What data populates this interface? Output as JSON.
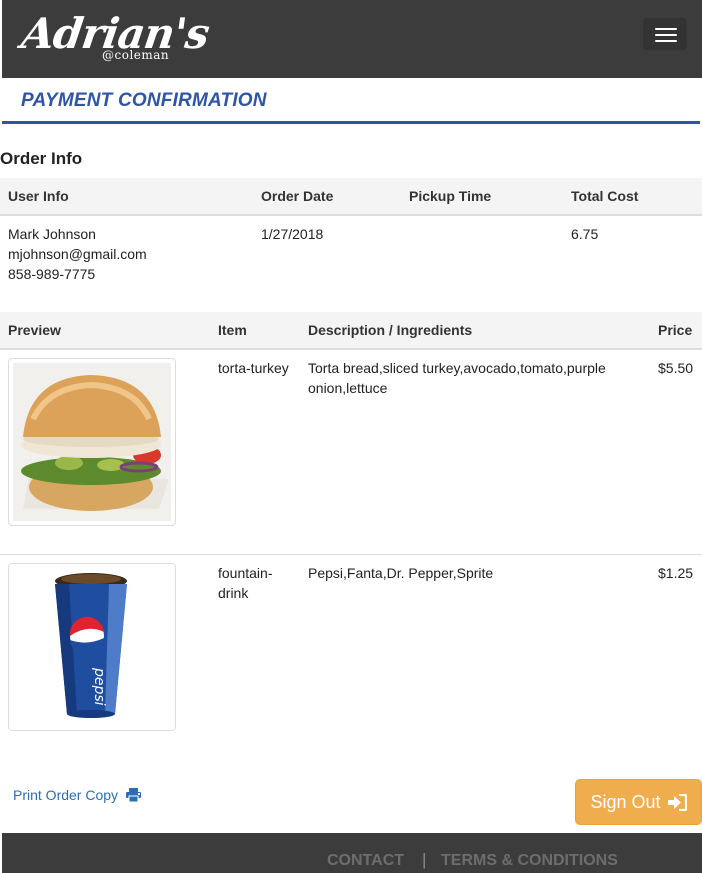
{
  "brand": {
    "name": "Adrian's",
    "sub": "@coleman"
  },
  "nav": {
    "menu_icon": "hamburger-icon"
  },
  "page_title": "PAYMENT CONFIRMATION",
  "order_info": {
    "heading": "Order Info",
    "columns": [
      "User Info",
      "Order Date",
      "Pickup Time",
      "Total Cost"
    ],
    "user": {
      "name": "Mark Johnson",
      "email": "mjohnson@gmail.com",
      "phone": "858-989-7775"
    },
    "order_date": "1/27/2018",
    "pickup_time": "",
    "total_cost": "6.75"
  },
  "items_table": {
    "columns": [
      "Preview",
      "Item",
      "Description / Ingredients",
      "Price"
    ],
    "rows": [
      {
        "item_line1": "torta-turkey",
        "item_line2": "",
        "desc_line1": "Torta bread,sliced turkey,avocado,tomato,purple",
        "desc_line2": "onion,lettuce",
        "price": "$5.50"
      },
      {
        "item_line1": "fountain-",
        "item_line2": "drink",
        "desc_line1": "Pepsi,Fanta,Dr. Pepper,Sprite",
        "desc_line2": "",
        "price": "$1.25"
      }
    ]
  },
  "actions": {
    "print_label": "Print Order Copy",
    "print_icon": "printer-icon",
    "signout_label": "Sign Out",
    "signout_icon": "sign-in-icon"
  },
  "footer": {
    "contact": "CONTACT",
    "separator": "|",
    "terms": "TERMS & CONDITIONS"
  },
  "colors": {
    "navbar": "#3c3c3c",
    "accent": "#2d56a7",
    "signout": "#f0ad4e",
    "link": "#2d6db4"
  }
}
